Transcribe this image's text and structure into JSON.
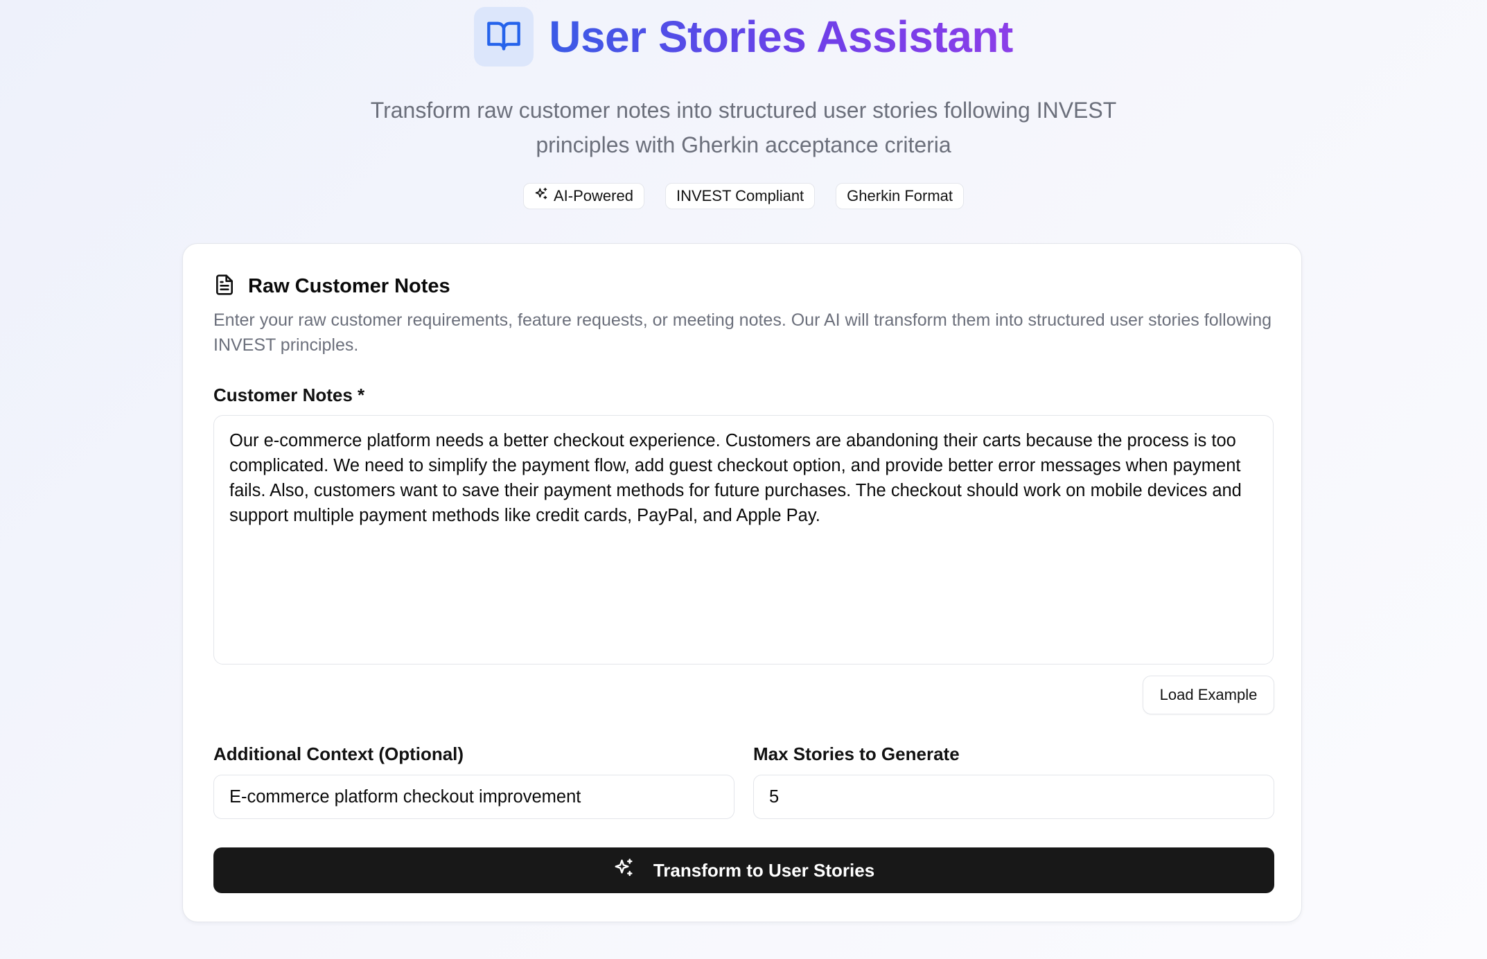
{
  "header": {
    "title": "User Stories Assistant",
    "subtitle": "Transform raw customer notes into structured user stories following INVEST principles with Gherkin acceptance criteria",
    "logo_icon": "book-open-icon",
    "badges": [
      {
        "label": "AI-Powered",
        "icon": "sparkles-icon"
      },
      {
        "label": "INVEST Compliant"
      },
      {
        "label": "Gherkin Format"
      }
    ]
  },
  "card": {
    "icon": "file-text-icon",
    "title": "Raw Customer Notes",
    "description": "Enter your raw customer requirements, feature requests, or meeting notes. Our AI will transform them into structured user stories following INVEST principles.",
    "notes_label": "Customer Notes *",
    "notes_value": "Our e-commerce platform needs a better checkout experience. Customers are abandoning their carts because the process is too complicated. We need to simplify the payment flow, add guest checkout option, and provide better error messages when payment fails. Also, customers want to save their payment methods for future purchases. The checkout should work on mobile devices and support multiple payment methods like credit cards, PayPal, and Apple Pay.",
    "load_example_label": "Load Example",
    "context_label": "Additional Context (Optional)",
    "context_value": "E-commerce platform checkout improvement",
    "max_stories_label": "Max Stories to Generate",
    "max_stories_value": "5",
    "submit_label": "Transform to User Stories",
    "submit_icon": "sparkles-icon"
  },
  "colors": {
    "title_gradient_start": "#3b5be6",
    "title_gradient_end": "#8b3ee8",
    "primary_button": "#181818",
    "logo_bg": "#dce6fb"
  }
}
